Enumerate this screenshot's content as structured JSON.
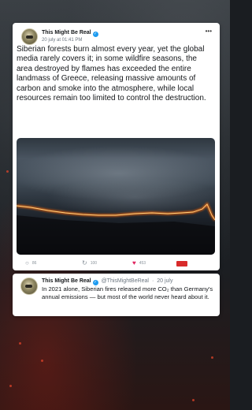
{
  "main_tweet": {
    "author": "This Might Be Real",
    "timestamp": "20 july at 01:41 PM",
    "more_label": "•••",
    "text": "Siberian forests burn almost every year, yet the global media rarely covers it; in some wildfire seasons, the area destroyed by flames has exceeded the entire landmass of Greece, releasing massive amounts of carbon and smoke into the atmosphere, while local resources remain too limited to control the destruction.",
    "media_icon": "wildfire-photo",
    "actions": {
      "replies": "86",
      "retweets": "100",
      "likes": "453"
    }
  },
  "reply_tweet": {
    "author": "This Might Be Real",
    "handle": "@ThisMightBeReal",
    "dot": "·",
    "date": "20 july",
    "text": "In 2021 alone, Siberian fires released more CO₂ than Germany's annual emissions — but most of the world never heard about it."
  },
  "icons": {
    "verified": "verified-badge-icon",
    "reply": "comment-icon",
    "retweet": "retweet-icon",
    "like": "heart-icon",
    "share": "share-icon"
  },
  "colors": {
    "verified": "#1d9bf0",
    "like": "#e0245e",
    "share": "#d82b2b",
    "fire": "#ff7a1a"
  }
}
